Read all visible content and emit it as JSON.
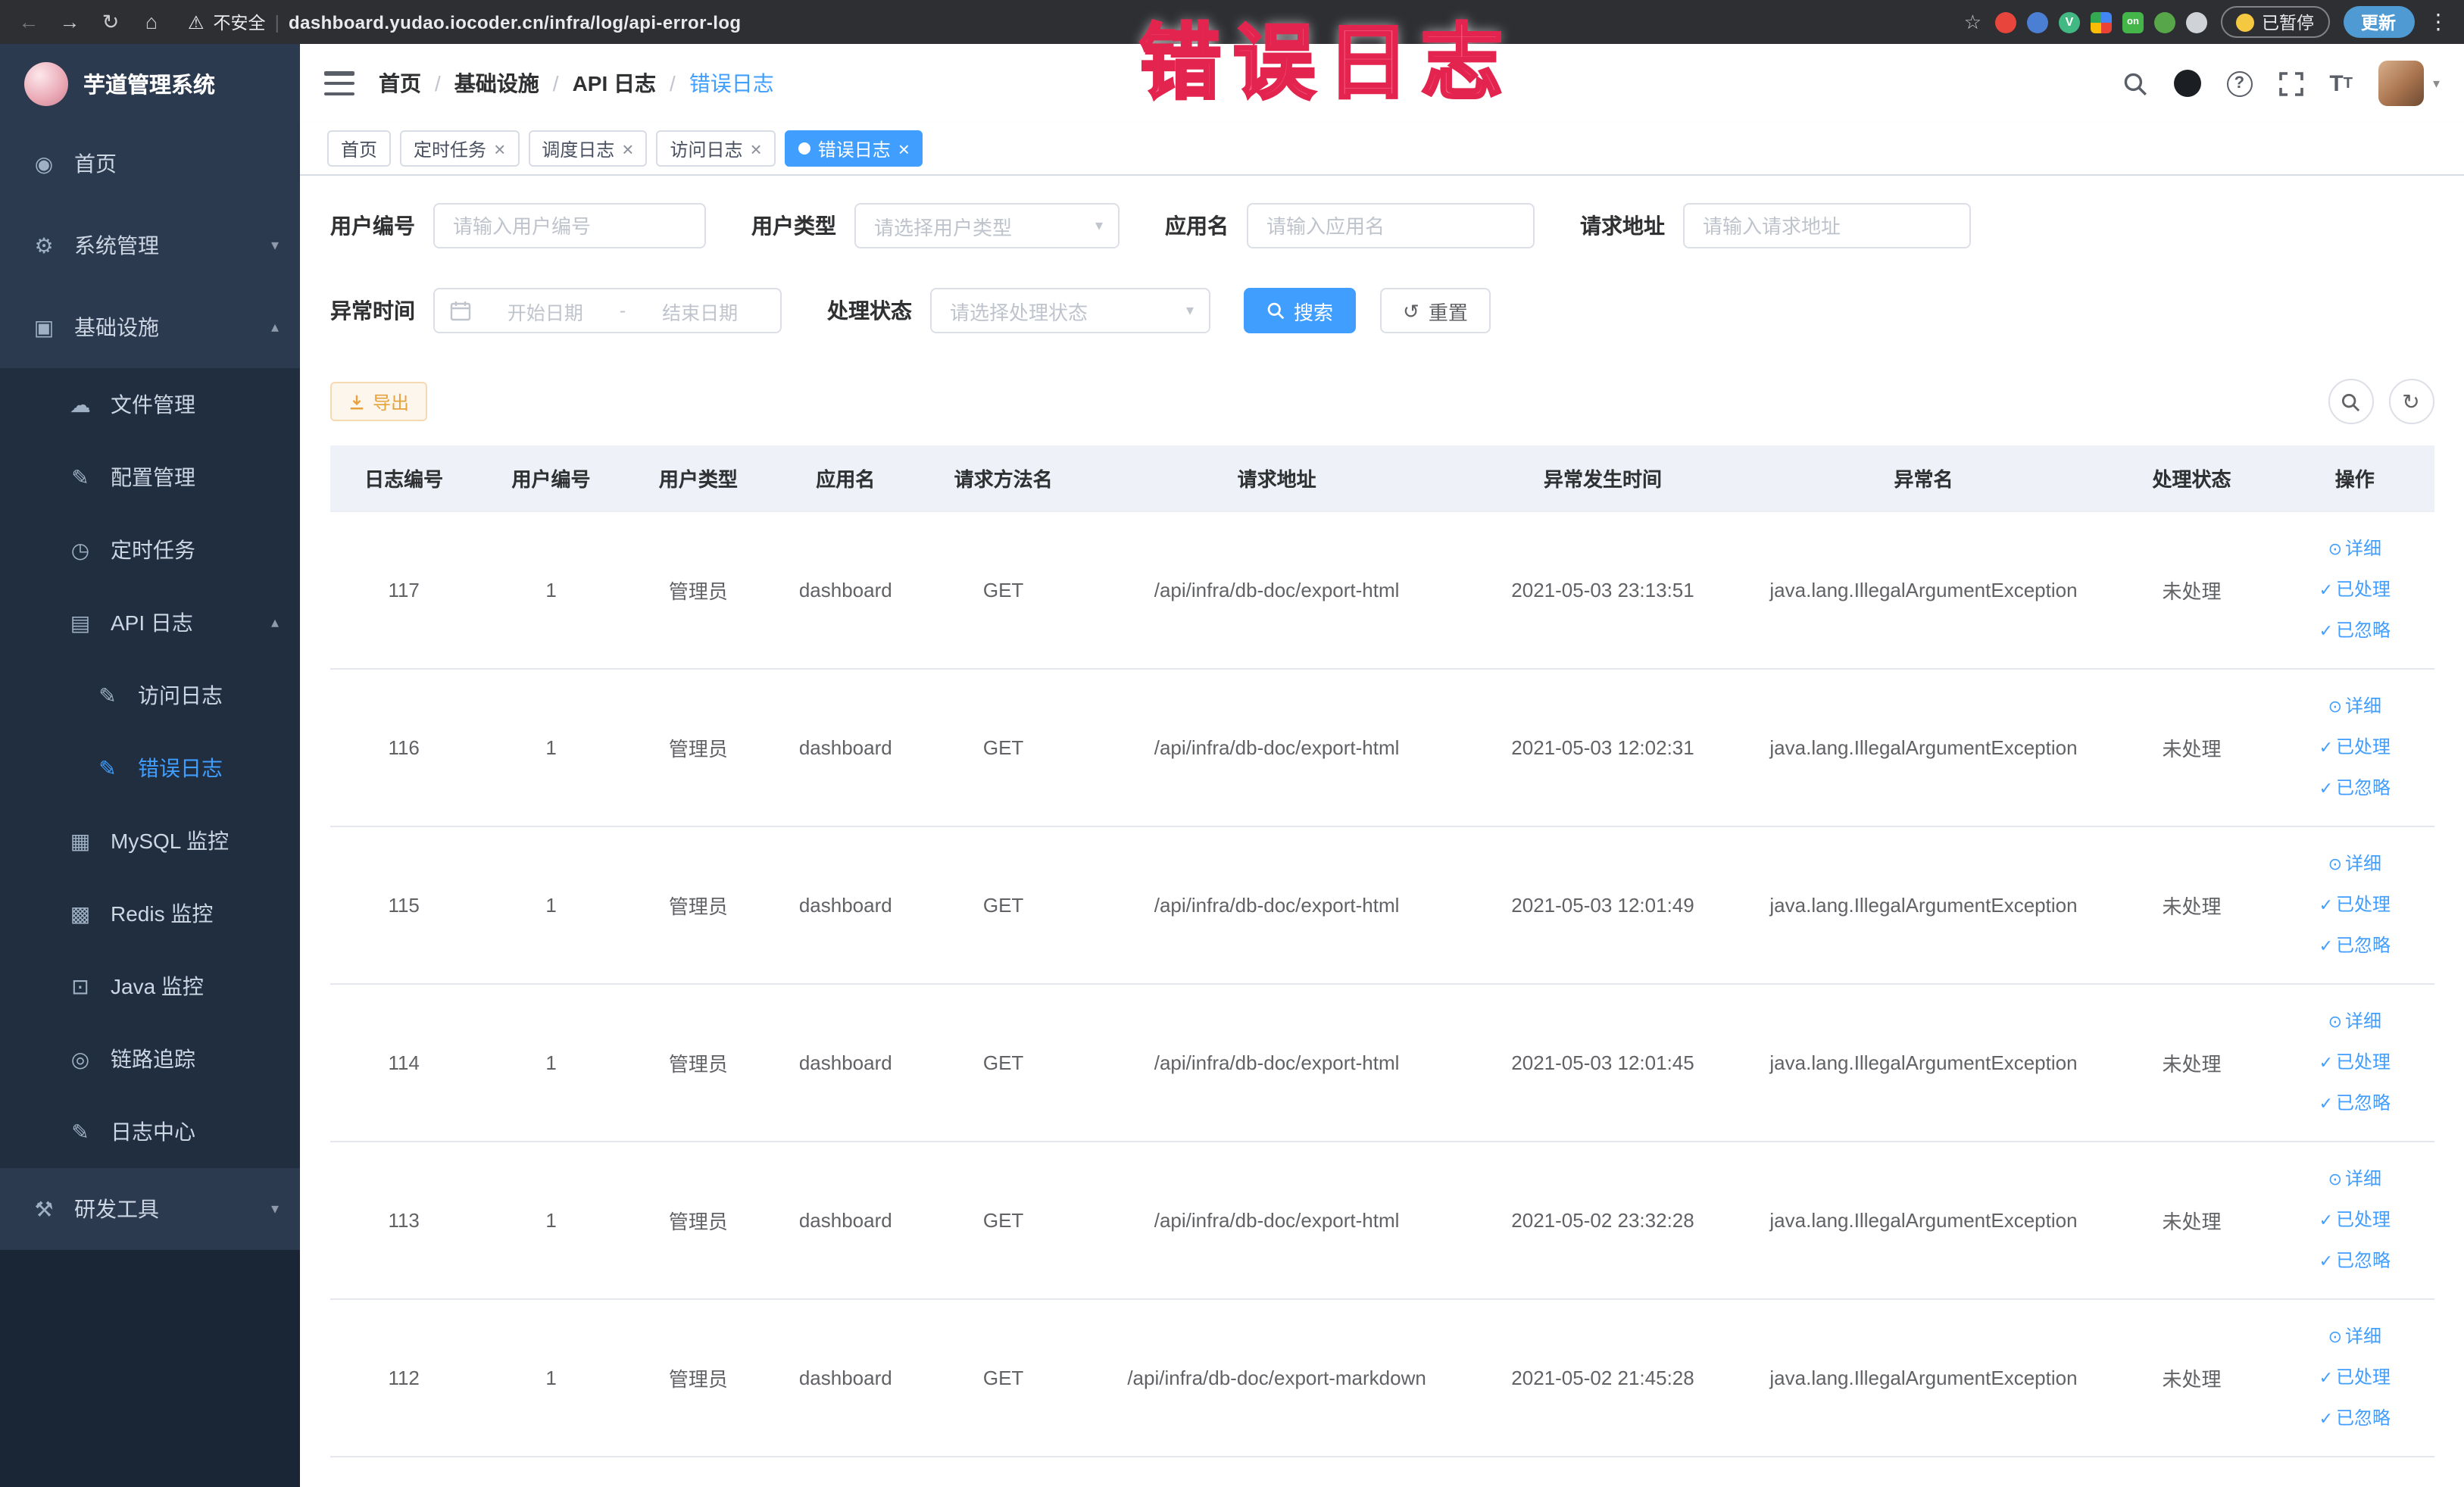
{
  "browser": {
    "security_label": "不安全",
    "url": "dashboard.yudao.iocoder.cn/infra/log/api-error-log",
    "paused_label": "已暂停",
    "update_label": "更新"
  },
  "overlay": {
    "text": "错误日志"
  },
  "sidebar": {
    "title": "芋道管理系统",
    "items": {
      "home": "首页",
      "system": "系统管理",
      "infra": "基础设施",
      "file": "文件管理",
      "config": "配置管理",
      "job": "定时任务",
      "api_log": "API 日志",
      "access_log": "访问日志",
      "error_log": "错误日志",
      "mysql": "MySQL 监控",
      "redis": "Redis 监控",
      "java": "Java 监控",
      "trace": "链路追踪",
      "log_center": "日志中心",
      "dev_tools": "研发工具"
    }
  },
  "breadcrumb": {
    "items": [
      "首页",
      "基础设施",
      "API 日志",
      "错误日志"
    ],
    "separator": "/"
  },
  "tabs": [
    {
      "label": "首页"
    },
    {
      "label": "定时任务"
    },
    {
      "label": "调度日志"
    },
    {
      "label": "访问日志"
    },
    {
      "label": "错误日志"
    }
  ],
  "filters": {
    "user_id": {
      "label": "用户编号",
      "placeholder": "请输入用户编号"
    },
    "user_type": {
      "label": "用户类型",
      "placeholder": "请选择用户类型"
    },
    "app_name": {
      "label": "应用名",
      "placeholder": "请输入应用名"
    },
    "request_url": {
      "label": "请求地址",
      "placeholder": "请输入请求地址"
    },
    "exception_time": {
      "label": "异常时间",
      "start_placeholder": "开始日期",
      "separator": "-",
      "end_placeholder": "结束日期"
    },
    "process_status": {
      "label": "处理状态",
      "placeholder": "请选择处理状态"
    },
    "search_label": "搜索",
    "reset_label": "重置"
  },
  "toolbar": {
    "export_label": "导出"
  },
  "table": {
    "columns": [
      "日志编号",
      "用户编号",
      "用户类型",
      "应用名",
      "请求方法名",
      "请求地址",
      "异常发生时间",
      "异常名",
      "处理状态",
      "操作"
    ],
    "actions": {
      "detail": "详细",
      "processed": "已处理",
      "ignored": "已忽略"
    },
    "rows": [
      {
        "id": "117",
        "user_id": "1",
        "user_type": "管理员",
        "app_name": "dashboard",
        "method": "GET",
        "url": "/api/infra/db-doc/export-html",
        "time": "2021-05-03 23:13:51",
        "exception": "java.lang.IllegalArgumentException",
        "status": "未处理"
      },
      {
        "id": "116",
        "user_id": "1",
        "user_type": "管理员",
        "app_name": "dashboard",
        "method": "GET",
        "url": "/api/infra/db-doc/export-html",
        "time": "2021-05-03 12:02:31",
        "exception": "java.lang.IllegalArgumentException",
        "status": "未处理"
      },
      {
        "id": "115",
        "user_id": "1",
        "user_type": "管理员",
        "app_name": "dashboard",
        "method": "GET",
        "url": "/api/infra/db-doc/export-html",
        "time": "2021-05-03 12:01:49",
        "exception": "java.lang.IllegalArgumentException",
        "status": "未处理"
      },
      {
        "id": "114",
        "user_id": "1",
        "user_type": "管理员",
        "app_name": "dashboard",
        "method": "GET",
        "url": "/api/infra/db-doc/export-html",
        "time": "2021-05-03 12:01:45",
        "exception": "java.lang.IllegalArgumentException",
        "status": "未处理"
      },
      {
        "id": "113",
        "user_id": "1",
        "user_type": "管理员",
        "app_name": "dashboard",
        "method": "GET",
        "url": "/api/infra/db-doc/export-html",
        "time": "2021-05-02 23:32:28",
        "exception": "java.lang.IllegalArgumentException",
        "status": "未处理"
      },
      {
        "id": "112",
        "user_id": "1",
        "user_type": "管理员",
        "app_name": "dashboard",
        "method": "GET",
        "url": "/api/infra/db-doc/export-markdown",
        "time": "2021-05-02 21:45:28",
        "exception": "java.lang.IllegalArgumentException",
        "status": "未处理"
      }
    ]
  },
  "colors": {
    "accent": "#409eff",
    "warning": "#e6a23c",
    "sidebar": "#2c3a4f",
    "annotation": "#e3244e"
  }
}
